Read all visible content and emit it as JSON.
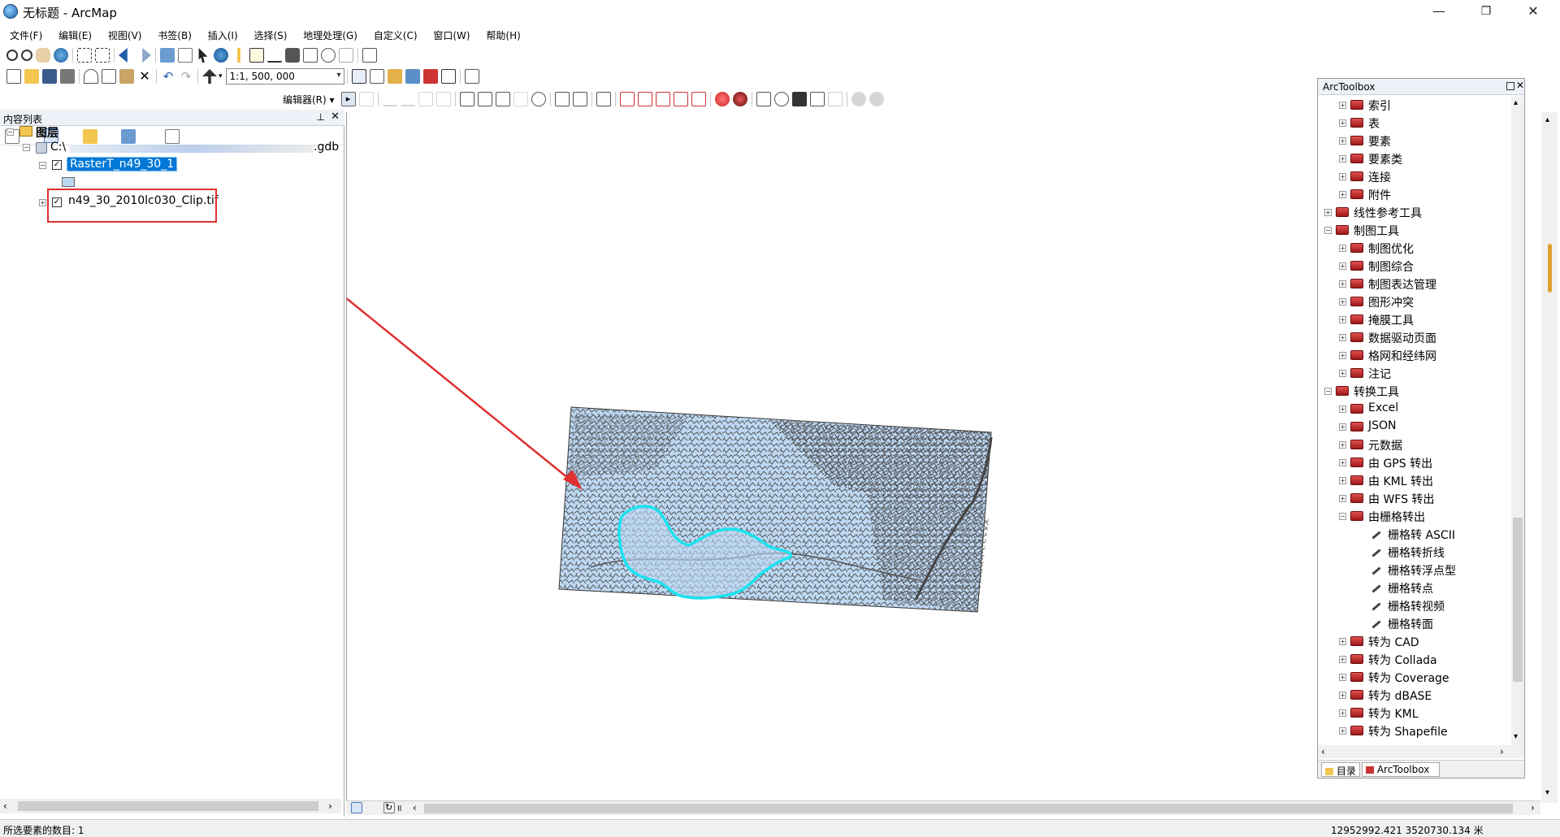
{
  "window": {
    "title": "无标题 - ArcMap",
    "minimize": "—",
    "maximize": "❐",
    "close": "✕"
  },
  "menu": [
    "文件(F)",
    "编辑(E)",
    "视图(V)",
    "书签(B)",
    "插入(I)",
    "选择(S)",
    "地理处理(G)",
    "自定义(C)",
    "窗口(W)",
    "帮助(H)"
  ],
  "toolbar": {
    "scale": "1:1, 500, 000",
    "editor_label": "编辑器(R) ▾"
  },
  "toc": {
    "title": "内容列表",
    "root": "图层",
    "gdb_prefix": "C:\\",
    "gdb_suffix": ".gdb",
    "layer1": "RasterT_n49_30_1",
    "layer2": "n49_30_2010lc030_Clip.tif"
  },
  "arctoolbox": {
    "title": "ArcToolbox",
    "items": [
      {
        "label": "索引",
        "level": 1,
        "kind": "toolset",
        "expander": "+"
      },
      {
        "label": "表",
        "level": 1,
        "kind": "toolset",
        "expander": "+"
      },
      {
        "label": "要素",
        "level": 1,
        "kind": "toolset",
        "expander": "+"
      },
      {
        "label": "要素类",
        "level": 1,
        "kind": "toolset",
        "expander": "+"
      },
      {
        "label": "连接",
        "level": 1,
        "kind": "toolset",
        "expander": "+"
      },
      {
        "label": "附件",
        "level": 1,
        "kind": "toolset",
        "expander": "+"
      },
      {
        "label": "线性参考工具",
        "level": 0,
        "kind": "toolbox",
        "expander": "+"
      },
      {
        "label": "制图工具",
        "level": 0,
        "kind": "toolbox",
        "expander": "−"
      },
      {
        "label": "制图优化",
        "level": 1,
        "kind": "toolset",
        "expander": "+"
      },
      {
        "label": "制图综合",
        "level": 1,
        "kind": "toolset",
        "expander": "+"
      },
      {
        "label": "制图表达管理",
        "level": 1,
        "kind": "toolset",
        "expander": "+"
      },
      {
        "label": "图形冲突",
        "level": 1,
        "kind": "toolset",
        "expander": "+"
      },
      {
        "label": "掩膜工具",
        "level": 1,
        "kind": "toolset",
        "expander": "+"
      },
      {
        "label": "数据驱动页面",
        "level": 1,
        "kind": "toolset",
        "expander": "+"
      },
      {
        "label": "格网和经纬网",
        "level": 1,
        "kind": "toolset",
        "expander": "+"
      },
      {
        "label": "注记",
        "level": 1,
        "kind": "toolset",
        "expander": "+"
      },
      {
        "label": "转换工具",
        "level": 0,
        "kind": "toolbox",
        "expander": "−"
      },
      {
        "label": "Excel",
        "level": 1,
        "kind": "toolset",
        "expander": "+"
      },
      {
        "label": "JSON",
        "level": 1,
        "kind": "toolset",
        "expander": "+"
      },
      {
        "label": "元数据",
        "level": 1,
        "kind": "toolset",
        "expander": "+"
      },
      {
        "label": "由 GPS 转出",
        "level": 1,
        "kind": "toolset",
        "expander": "+"
      },
      {
        "label": "由 KML 转出",
        "level": 1,
        "kind": "toolset",
        "expander": "+"
      },
      {
        "label": "由 WFS 转出",
        "level": 1,
        "kind": "toolset",
        "expander": "+"
      },
      {
        "label": "由栅格转出",
        "level": 1,
        "kind": "toolset",
        "expander": "−"
      },
      {
        "label": "栅格转 ASCII",
        "level": 2,
        "kind": "tool",
        "expander": ""
      },
      {
        "label": "栅格转折线",
        "level": 2,
        "kind": "tool",
        "expander": ""
      },
      {
        "label": "栅格转浮点型",
        "level": 2,
        "kind": "tool",
        "expander": ""
      },
      {
        "label": "栅格转点",
        "level": 2,
        "kind": "tool",
        "expander": ""
      },
      {
        "label": "栅格转视频",
        "level": 2,
        "kind": "tool",
        "expander": ""
      },
      {
        "label": "栅格转面",
        "level": 2,
        "kind": "tool",
        "expander": ""
      },
      {
        "label": "转为 CAD",
        "level": 1,
        "kind": "toolset",
        "expander": "+"
      },
      {
        "label": "转为 Collada",
        "level": 1,
        "kind": "toolset",
        "expander": "+"
      },
      {
        "label": "转为 Coverage",
        "level": 1,
        "kind": "toolset",
        "expander": "+"
      },
      {
        "label": "转为 dBASE",
        "level": 1,
        "kind": "toolset",
        "expander": "+"
      },
      {
        "label": "转为 KML",
        "level": 1,
        "kind": "toolset",
        "expander": "+"
      },
      {
        "label": "转为 Shapefile",
        "level": 1,
        "kind": "toolset",
        "expander": "+"
      }
    ],
    "tab_catalog": "目录",
    "tab_arctoolbox": "ArcToolbox"
  },
  "status": {
    "selected": "所选要素的数目: 1",
    "coords": "12952992.421  3520730.134 米"
  },
  "colors": {
    "selection": "#0078d7",
    "raster_fill": "#bcd7f2",
    "raster_lines": "#555555",
    "polygon_outline": "#19e3f0",
    "annotation": "#e03030"
  }
}
